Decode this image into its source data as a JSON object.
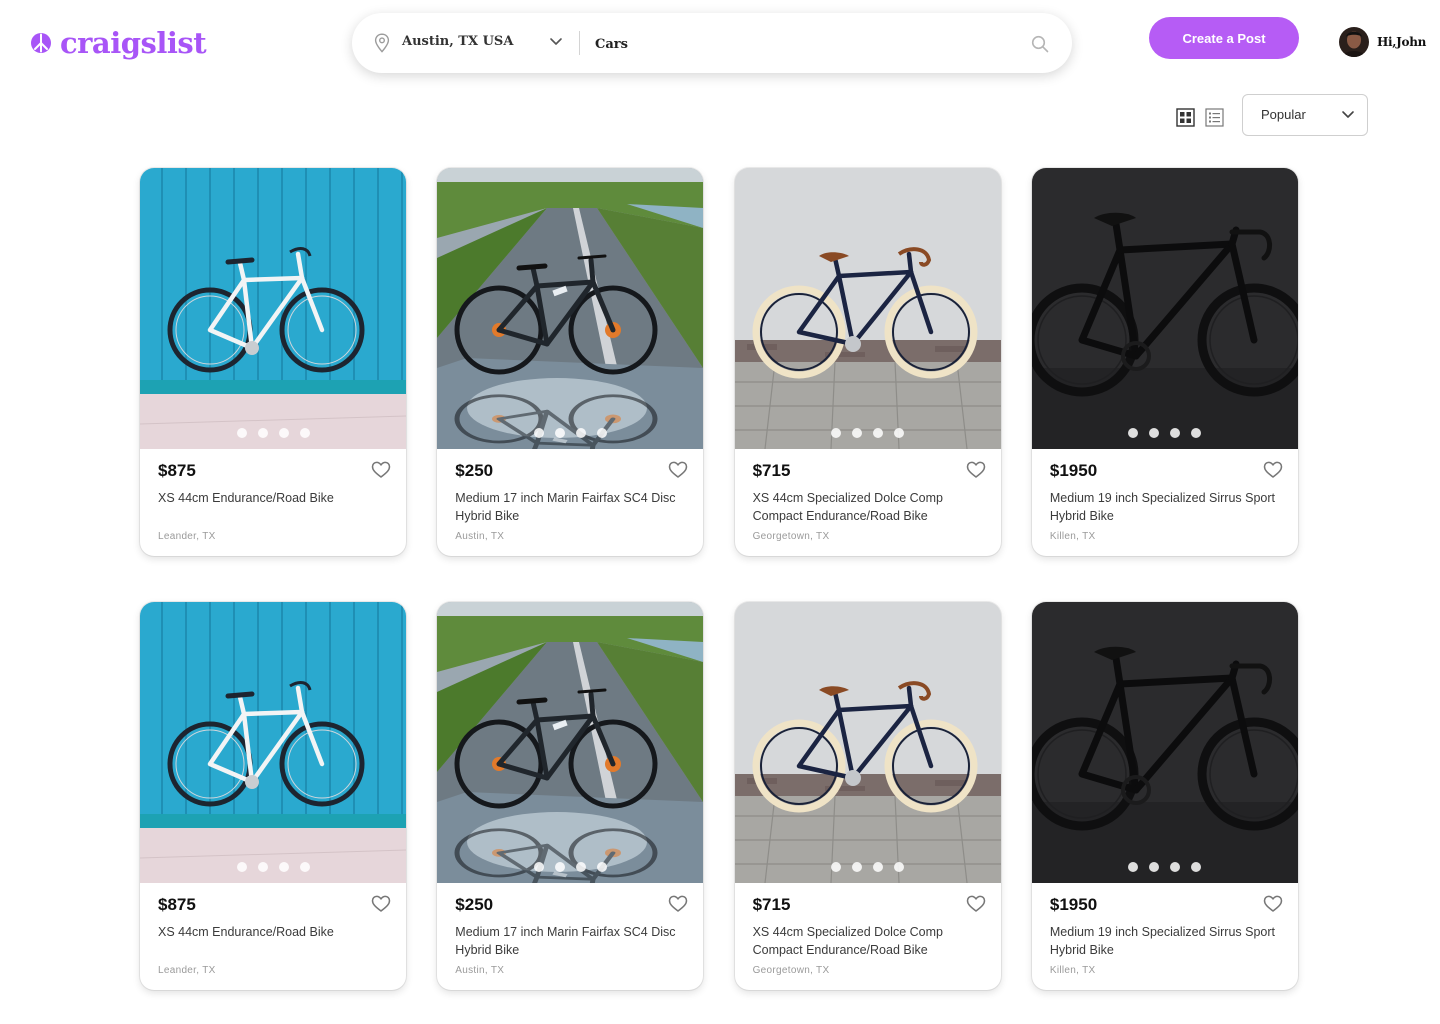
{
  "brand": {
    "name": "craigslist",
    "icon": "peace-icon",
    "color": "#a855f7"
  },
  "search": {
    "location": "Austin, TX USA",
    "query": "Cars",
    "placeholder": "",
    "icons": {
      "location": "location-pin-icon",
      "dropdown": "chevron-down-icon",
      "search": "search-icon"
    }
  },
  "header": {
    "create_post_label": "Create a Post",
    "create_post_color": "#b65cf5",
    "greeting": "Hi,John"
  },
  "toolbar": {
    "views": [
      "grid-view-icon",
      "list-view-icon"
    ],
    "active_view": "grid",
    "sort_selected": "Popular"
  },
  "listings": [
    {
      "price": "$875",
      "title": "XS 44cm Endurance/Road Bike",
      "location": "Leander, TX",
      "image": "white bike against teal wooden wall",
      "image_count": 4
    },
    {
      "price": "$250",
      "title": "Medium 17 inch Marin Fairfax SC4 Disc Hybrid Bike",
      "location": "Austin, TX",
      "image": "black bike on wet road with reflection",
      "image_count": 4
    },
    {
      "price": "$715",
      "title": "XS 44cm Specialized Dolce Comp Compact Endurance/Road Bike",
      "location": "Georgetown, TX",
      "image": "navy bike with cream tires against white wall",
      "image_count": 4
    },
    {
      "price": "$1950",
      "title": "Medium 19 inch Specialized Sirrus Sport Hybrid Bike",
      "location": "Killen, TX",
      "image": "black road bike on dark background",
      "image_count": 4
    },
    {
      "price": "$875",
      "title": "XS 44cm Endurance/Road Bike",
      "location": "Leander, TX",
      "image": "white bike against teal wooden wall",
      "image_count": 4
    },
    {
      "price": "$250",
      "title": "Medium 17 inch Marin Fairfax SC4 Disc Hybrid Bike",
      "location": "Austin, TX",
      "image": "black bike on wet road with reflection",
      "image_count": 4
    },
    {
      "price": "$715",
      "title": "XS 44cm Specialized Dolce Comp Compact Endurance/Road Bike",
      "location": "Georgetown, TX",
      "image": "navy bike with cream tires against white wall",
      "image_count": 4
    },
    {
      "price": "$1950",
      "title": "Medium 19 inch Specialized Sirrus Sport Hybrid Bike",
      "location": "Killen, TX",
      "image": "black road bike on dark background",
      "image_count": 4
    }
  ]
}
